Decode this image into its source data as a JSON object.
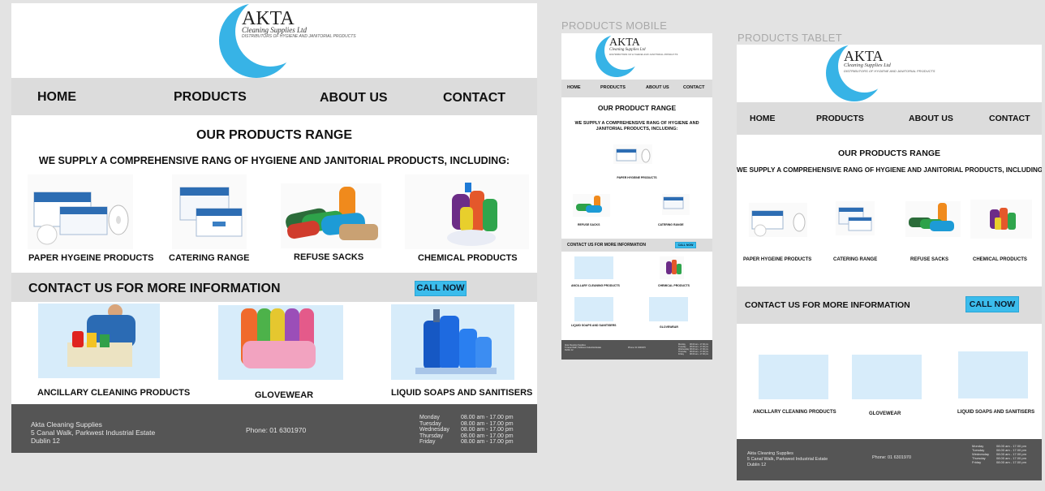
{
  "labels": {
    "mobile": "PRODUCTS MOBILE",
    "tablet": "PRODUCTS TABLET"
  },
  "brand": {
    "name": "AKTA",
    "subtitle": "Cleaning Supplies Ltd",
    "tagline": "DISTRIBUTORS OF HYGIENE AND JANITORIAL PRODUCTS"
  },
  "nav": {
    "home": "HOME",
    "products": "PRODUCTS",
    "about": "ABOUT US",
    "contact": "CONTACT"
  },
  "section": {
    "title": "OUR PRODUCTS RANGE",
    "title_mobile": "OUR PRODUCT RANGE",
    "subtitle": "WE SUPPLY A COMPREHENSIVE RANG OF HYGIENE AND JANITORIAL PRODUCTS, INCLUDING:"
  },
  "products": {
    "paper": "PAPER HYGEINE PRODUCTS",
    "catering": "CATERING RANGE",
    "refuse": "REFUSE SACKS",
    "chemical": "CHEMICAL PRODUCTS"
  },
  "contact": {
    "text": "CONTACT US FOR MORE INFORMATION",
    "button": "CALL NOW"
  },
  "more": {
    "ancillary": "ANCILLARY CLEANING PRODUCTS",
    "glovewear": "GLOVEWEAR",
    "liquid": "LIQUID SOAPS AND SANITISERS"
  },
  "footer": {
    "company": "Akta Cleaning Supplies",
    "address1": "5 Canal Walk, Parkwest Industrial Estate",
    "address2": "Dublin 12",
    "phone": "Phone: 01 6301970",
    "days": [
      "Monday",
      "Tuesday",
      "Wednesday",
      "Thursday",
      "Friday"
    ],
    "hours": [
      "08.00 am - 17.00 pm",
      "08.00 am - 17.00 pm",
      "08.00 am - 17.00 pm",
      "08.00 am - 17.00 pm",
      "08.00 am - 17.00 pm"
    ]
  },
  "colors": {
    "accent": "#37b3e6",
    "nav_bg": "#dcdcdc",
    "footer_bg": "#555555",
    "button": "#3bbcec"
  }
}
